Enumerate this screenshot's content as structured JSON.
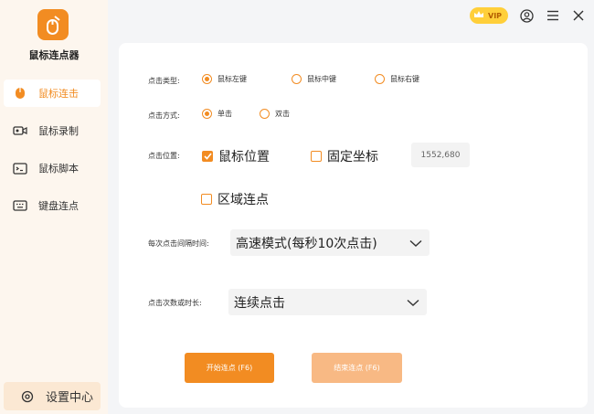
{
  "app": {
    "name": "鼠标连点器"
  },
  "sidebar": {
    "items": [
      {
        "label": "鼠标连击",
        "icon": "mouse-icon",
        "active": true
      },
      {
        "label": "鼠标录制",
        "icon": "record-icon",
        "active": false
      },
      {
        "label": "鼠标脚本",
        "icon": "script-icon",
        "active": false
      },
      {
        "label": "键盘连点",
        "icon": "keyboard-icon",
        "active": false
      }
    ],
    "settings_label": "设置中心"
  },
  "topbar": {
    "vip_label": "VIP"
  },
  "form": {
    "click_type": {
      "label": "点击类型:",
      "options": [
        "鼠标左键",
        "鼠标中键",
        "鼠标右键"
      ],
      "selected": "鼠标左键"
    },
    "click_mode": {
      "label": "点击方式:",
      "options": [
        "单击",
        "双击"
      ],
      "selected": "单击"
    },
    "click_position": {
      "label": "点击位置:",
      "mouse_position_label": "鼠标位置",
      "mouse_position_checked": true,
      "fixed_coord_label": "固定坐标",
      "fixed_coord_checked": false,
      "coord_value": "1552,680",
      "area_label": "区域连点",
      "area_checked": false
    },
    "interval": {
      "label": "每次点击间隔时间:",
      "value": "高速模式(每秒10次点击)"
    },
    "count": {
      "label": "点击次数或时长:",
      "value": "连续点击"
    }
  },
  "buttons": {
    "start_label": "开始连点 (F6)",
    "stop_label": "结束连点 (F6)"
  },
  "colors": {
    "accent": "#f28c22",
    "accent_light": "#f8b984",
    "sidebar_bg": "#fdf6ee"
  }
}
